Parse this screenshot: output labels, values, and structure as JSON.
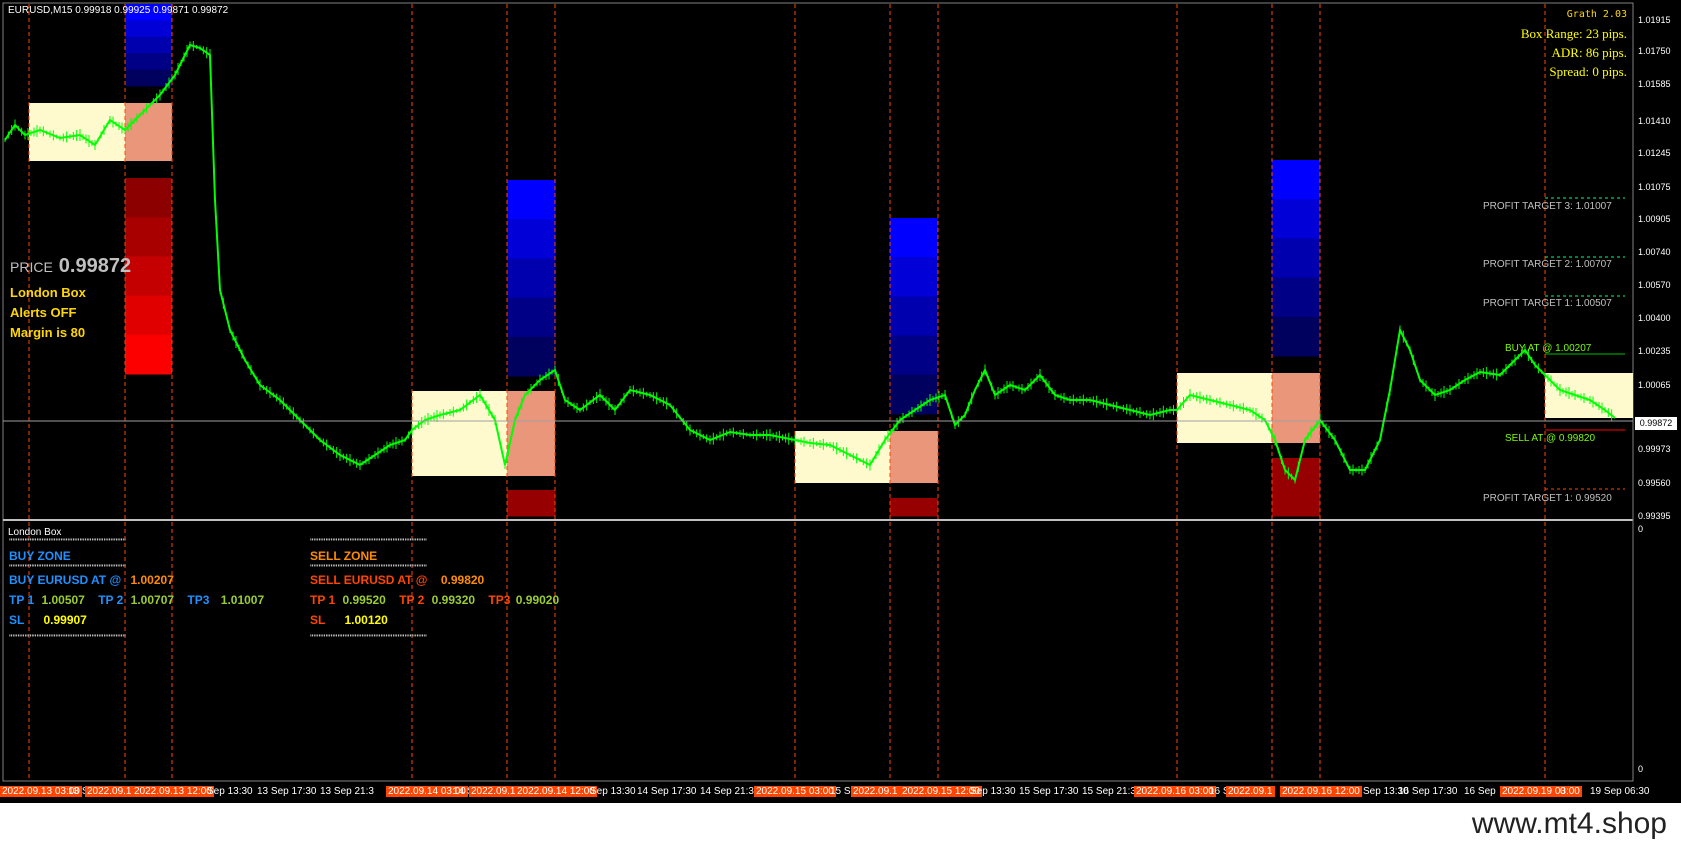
{
  "window": {
    "symbol_info": "EURUSD,M15  0.99918 0.99925 0.99871 0.99872"
  },
  "colors": {
    "background": "#000000",
    "candle": "#00ff00",
    "box_fill": "#fffacd",
    "box_sell": "#e9967a",
    "zone_blue": "#0000ff",
    "zone_red": "#ff0000",
    "session_line": "#ff4500"
  },
  "indicator": {
    "grath": "Grath 2.03",
    "box_range": "Box Range: 23 pips.",
    "adr": "ADR: 86 pips.",
    "spread": "Spread: 0 pips.",
    "price_label": "PRICE",
    "price_value": "0.99872",
    "london_box": "London Box",
    "alerts": "Alerts OFF",
    "margin": "Margin is 80"
  },
  "levels": {
    "pt3_buy": "PROFIT TARGET 3: 1.01007",
    "pt2_buy": "PROFIT TARGET 2: 1.00707",
    "pt1_buy": "PROFIT TARGET 1: 1.00507",
    "buy_at": "BUY AT @ 1.00207",
    "sell_at": "SELL AT @ 0.99820",
    "pt1_sell": "PROFIT TARGET 1: 0.99520"
  },
  "price_axis": [
    "1.01915",
    "1.01750",
    "1.01585",
    "1.01410",
    "1.01245",
    "1.01075",
    "1.00905",
    "1.00740",
    "1.00570",
    "1.00400",
    "1.00235",
    "1.00065",
    "0.99973",
    "0.99560",
    "0.99395"
  ],
  "current_price": "0.99872",
  "subwindow": {
    "title": "London Box",
    "axis_top": "0",
    "axis_bottom": "0",
    "divider": "''''''''''''''''''''''''''''''''''''''''''''''''''''''''''''''''''''",
    "buy": {
      "zone": "BUY ZONE",
      "at_label": "BUY EURUSD AT @",
      "at_value": "1.00207",
      "tp1_label": "TP 1",
      "tp1": "1.00507",
      "tp2_label": "TP 2",
      "tp2": "1.00707",
      "tp3_label": "TP3",
      "tp3": "1.01007",
      "sl_label": "SL",
      "sl": "0.99907"
    },
    "sell": {
      "zone": "SELL ZONE",
      "at_label": "SELL EURUSD AT @",
      "at_value": "0.99820",
      "tp1_label": "TP 1",
      "tp1": "0.99520",
      "tp2_label": "TP 2",
      "tp2": "0.99320",
      "tp3_label": "TP3",
      "tp3": "0.99020",
      "sl_label": "SL",
      "sl": "1.00120"
    }
  },
  "time_axis": [
    {
      "label": "2022.09.13 03:00",
      "red": true
    },
    {
      "label": "13 S",
      "red": false
    },
    {
      "label": "2022.09.1",
      "red": true
    },
    {
      "label": "2022.09.13 12:00",
      "red": true
    },
    {
      "label": "Sep 13:30",
      "red": false
    },
    {
      "label": "13 Sep 17:30",
      "red": false
    },
    {
      "label": "13 Sep 21:3",
      "red": false
    },
    {
      "label": "2022.09.14 03:00",
      "red": true
    },
    {
      "label": "14 S",
      "red": false
    },
    {
      "label": "2022.09.1",
      "red": true
    },
    {
      "label": "2022.09.14 12:00",
      "red": true
    },
    {
      "label": "Sep 13:30",
      "red": false
    },
    {
      "label": "14 Sep 17:30",
      "red": false
    },
    {
      "label": "14 Sep 21:3",
      "red": false
    },
    {
      "label": "2022.09.15 03:00",
      "red": true
    },
    {
      "label": "15 S",
      "red": false
    },
    {
      "label": "2022.09.1",
      "red": true
    },
    {
      "label": "2022.09.15 12:00",
      "red": true
    },
    {
      "label": "Sep 13:30",
      "red": false
    },
    {
      "label": "15 Sep 17:30",
      "red": false
    },
    {
      "label": "15 Sep 21:3",
      "red": false
    },
    {
      "label": "2022.09.16 03:00",
      "red": true
    },
    {
      "label": "16 S",
      "red": false
    },
    {
      "label": "2022.09.1",
      "red": true
    },
    {
      "label": "2022.09.16 12:00",
      "red": true
    },
    {
      "label": "Sep 13:30",
      "red": false
    },
    {
      "label": "16 Sep 17:30",
      "red": false
    },
    {
      "label": "16 Sep",
      "red": false
    },
    {
      "label": "2022.09.19 03:00",
      "red": true
    },
    {
      "label": "0",
      "red": false
    },
    {
      "label": "19 Sep 06:30",
      "red": false
    }
  ],
  "watermark": "www.mt4.shop"
}
